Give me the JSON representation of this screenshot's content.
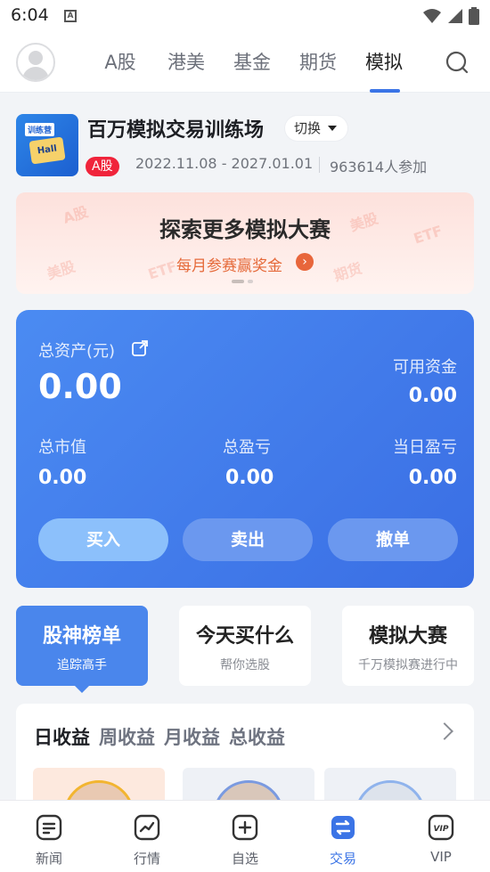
{
  "status_bar": {
    "time": "6:04",
    "notification_letter": "A"
  },
  "top_nav": {
    "tabs": [
      "A股",
      "港美",
      "基金",
      "期货",
      "模拟"
    ],
    "active_tab": "模拟"
  },
  "contest": {
    "logo_tag": "训练营",
    "logo_text": "Hall",
    "title": "百万模拟交易训练场",
    "switch_label": "切换",
    "market_badge": "A股",
    "dates": "2022.11.08 - 2027.01.01",
    "participants": "963614人参加"
  },
  "banner": {
    "title": "探索更多模拟大赛",
    "subtitle": "每月参赛赢奖金",
    "watermarks": [
      "A股",
      "美股",
      "ETF",
      "美股",
      "期货",
      "ETF"
    ]
  },
  "assets": {
    "total_label": "总资产(元)",
    "total_value": "0.00",
    "available_label": "可用资金",
    "available_value": "0.00",
    "market_value_label": "总市值",
    "market_value": "0.00",
    "total_pl_label": "总盈亏",
    "total_pl": "0.00",
    "daily_pl_label": "当日盈亏",
    "daily_pl": "0.00",
    "buy_label": "买入",
    "sell_label": "卖出",
    "cancel_label": "撤单"
  },
  "features": [
    {
      "title": "股神榜单",
      "subtitle": "追踪高手"
    },
    {
      "title": "今天买什么",
      "subtitle": "帮你选股"
    },
    {
      "title": "模拟大赛",
      "subtitle": "千万模拟赛进行中"
    }
  ],
  "earnings": {
    "tabs": [
      "日收益",
      "周收益",
      "月收益",
      "总收益"
    ]
  },
  "bottom_nav": {
    "items": [
      "新闻",
      "行情",
      "自选",
      "交易",
      "VIP"
    ],
    "active": "交易"
  },
  "colors": {
    "accent": "#3b74e6",
    "asset_card": "#4a82ee",
    "badge_red": "#f0243b",
    "banner_orange": "#e8663b"
  }
}
